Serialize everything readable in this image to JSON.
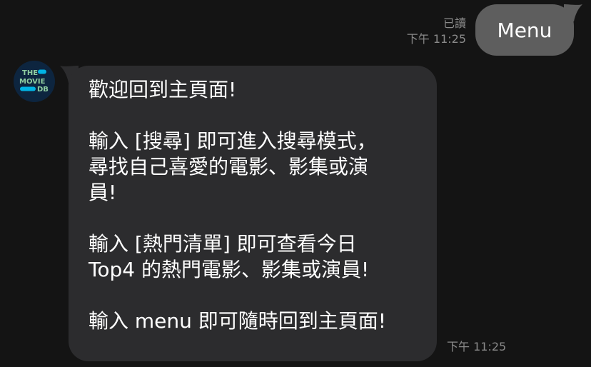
{
  "outgoing": {
    "read_status": "已讀",
    "time": "下午 11:25",
    "text": "Menu"
  },
  "bot": {
    "avatar_lines": [
      "THE",
      "MOVIE",
      "DB"
    ],
    "avatar_colors": {
      "background": "#0d253f",
      "green": "#90cea1",
      "blue": "#01b4e4"
    }
  },
  "incoming": {
    "paragraphs": [
      "歡迎回到主頁面!",
      "輸入 [搜尋] 即可進入搜尋模式，\n尋找自己喜愛的電影、影集或演\n員!",
      "輸入 [熱門清單] 即可查看今日\nTop4 的熱門電影、影集或演員!",
      "輸入 menu 即可隨時回到主頁面!"
    ],
    "time": "下午 11:25"
  },
  "colors": {
    "background": "#141414",
    "outgoing_bubble": "#5e5e5e",
    "incoming_bubble": "#2c2c2e",
    "meta_text": "#8a8a8a",
    "message_text": "#ffffff"
  }
}
